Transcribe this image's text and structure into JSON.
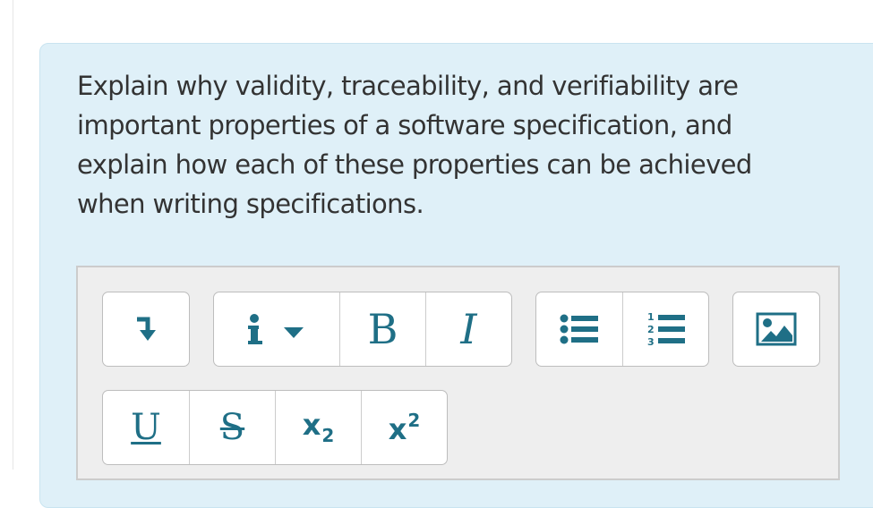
{
  "question": {
    "text": "Explain why validity, traceability, and verifiability are important properties of a software specification, and explain how each of these properties can be achieved when writing specifications."
  },
  "toolbar": {
    "row1": {
      "group1": [
        {
          "icon": "indent-arrow-icon",
          "action": "indent"
        }
      ],
      "group2": [
        {
          "icon": "info-dropdown-icon",
          "action": "insert-info"
        },
        {
          "icon": "bold-icon",
          "label": "B",
          "action": "bold"
        },
        {
          "icon": "italic-icon",
          "label": "I",
          "action": "italic"
        }
      ],
      "group3": [
        {
          "icon": "bulleted-list-icon",
          "action": "bulleted-list"
        },
        {
          "icon": "numbered-list-icon",
          "action": "numbered-list"
        }
      ],
      "group4": [
        {
          "icon": "image-icon",
          "action": "insert-image"
        }
      ]
    },
    "row2": {
      "group1": [
        {
          "icon": "underline-icon",
          "label": "U",
          "action": "underline"
        },
        {
          "icon": "strikethrough-icon",
          "label": "S",
          "action": "strikethrough"
        },
        {
          "icon": "subscript-icon",
          "label": "x",
          "suffix": "2",
          "action": "subscript"
        },
        {
          "icon": "superscript-icon",
          "label": "x",
          "suffix": "2",
          "action": "superscript"
        }
      ]
    }
  },
  "colors": {
    "icon": "#1f6f86",
    "card_background": "#dff0f8",
    "editor_background": "#eeeeee",
    "question_text": "#333333"
  }
}
